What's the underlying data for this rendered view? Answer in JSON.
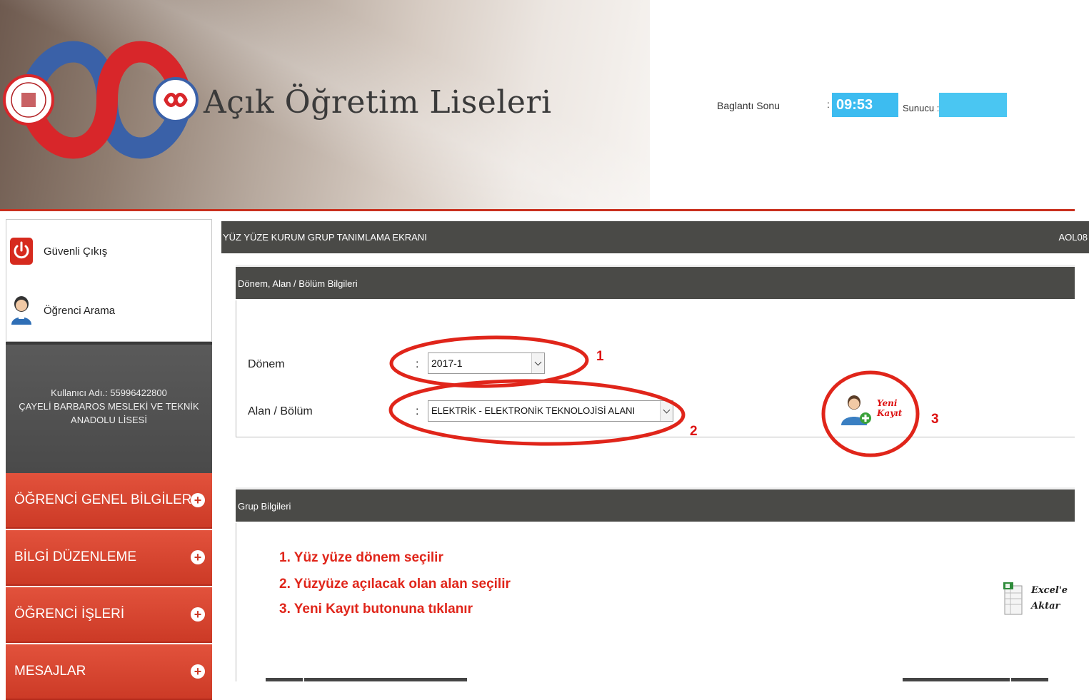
{
  "header": {
    "site_title": "Açık Öğretim Liseleri",
    "connection_label": "Baglantı Sonu",
    "connection_colon": ":",
    "timer": "09:53",
    "server_label": "Sunucu :",
    "server_value": ""
  },
  "sidebar": {
    "links": [
      {
        "label": "Güvenli Çıkış",
        "icon": "power-icon"
      },
      {
        "label": "Öğrenci Arama",
        "icon": "user-search-icon"
      }
    ],
    "user": {
      "line1": "Kullanıcı Adı.: 55996422800",
      "line2": "ÇAYELİ BARBAROS MESLEKİ VE TEKNİK",
      "line3": "ANADOLU LİSESİ"
    },
    "menu": [
      {
        "label": "ÖĞRENCİ GENEL BİLGİLER"
      },
      {
        "label": "BİLGİ DÜZENLEME"
      },
      {
        "label": "ÖĞRENCİ İŞLERİ"
      },
      {
        "label": "MESAJLAR"
      }
    ]
  },
  "main": {
    "screen_title": "YÜZ YÜZE KURUM GRUP TANIMLAMA EKRANI",
    "screen_code": "AOL08",
    "panel1": {
      "title": "Dönem, Alan / Bölüm Bilgileri",
      "donem_label": "Dönem",
      "donem_value": "2017-1",
      "alan_label": "Alan / Bölüm",
      "alan_value": "ELEKTRİK - ELEKTRONİK TEKNOLOJİSİ ALANI",
      "colon": ":",
      "new_record_line1": "Yeni",
      "new_record_line2": "Kayıt"
    },
    "panel2": {
      "title": "Grup Bilgileri",
      "instructions": [
        "1. Yüz yüze dönem seçilir",
        "2. Yüzyüze açılacak olan alan seçilir",
        "3. Yeni Kayıt butonuna tıklanır"
      ],
      "excel_line1": "Excel'e",
      "excel_line2": "Aktar"
    }
  },
  "annotations": {
    "n1": "1",
    "n2": "2",
    "n3": "3",
    "color": "#e0251a"
  },
  "colors": {
    "accent_red": "#cc3a26",
    "header_rule": "#c9301e",
    "timer_blue": "#3dbcf0",
    "panel_dark": "#4a4a47"
  }
}
